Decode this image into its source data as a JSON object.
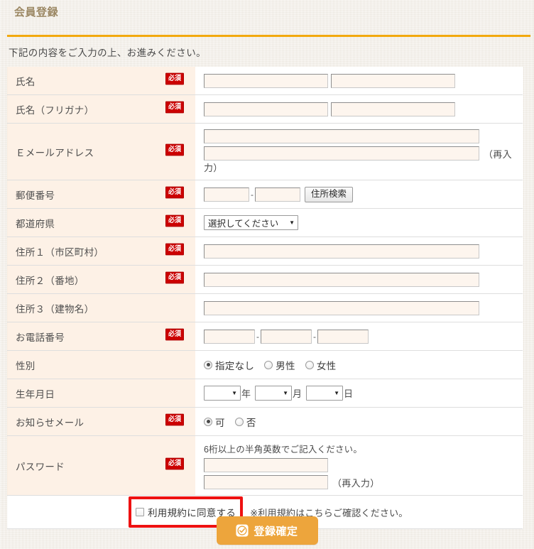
{
  "header": {
    "title": "会員登録",
    "intro": "下記の内容をご入力の上、お進みください。"
  },
  "badges": {
    "required": "必須"
  },
  "rows": [
    {
      "label": "氏名",
      "required": true
    },
    {
      "label": "氏名（フリガナ）",
      "required": true
    },
    {
      "label": "Ｅメールアドレス",
      "required": true,
      "reenter_note": "（再入力）"
    },
    {
      "label": "郵便番号",
      "required": true,
      "separator": "-",
      "search_button": "住所検索"
    },
    {
      "label": "都道府県",
      "required": true,
      "select_value": "選択してください"
    },
    {
      "label": "住所１（市区町村）",
      "required": true
    },
    {
      "label": "住所２（番地）",
      "required": true
    },
    {
      "label": "住所３（建物名）",
      "required": false
    },
    {
      "label": "お電話番号",
      "required": true,
      "separator": "-"
    },
    {
      "label": "性別",
      "required": false,
      "options": [
        "指定なし",
        "男性",
        "女性"
      ],
      "selected": "指定なし"
    },
    {
      "label": "生年月日",
      "required": false,
      "units": [
        "年",
        "月",
        "日"
      ],
      "select_value": ""
    },
    {
      "label": "お知らせメール",
      "required": true,
      "options": [
        "可",
        "否"
      ],
      "selected": "可"
    },
    {
      "label": "パスワード",
      "required": true,
      "hint": "6桁以上の半角英数でご記入ください。",
      "reenter_note": "（再入力）"
    }
  ],
  "terms": {
    "checkbox_label": "利用規約に同意する",
    "checked": false,
    "note": "※利用規約はこちらご確認ください。"
  },
  "submit": {
    "label": "登録確定",
    "icon": "check-circle-icon"
  },
  "colors": {
    "accent_gold": "#f2a90f",
    "required_red": "#cc0000",
    "highlight_red": "#ee1111",
    "submit_orange": "#eda53c",
    "label_bg": "#fdf1e6",
    "input_bg": "#fdf5ee",
    "title_text": "#9b8763"
  }
}
